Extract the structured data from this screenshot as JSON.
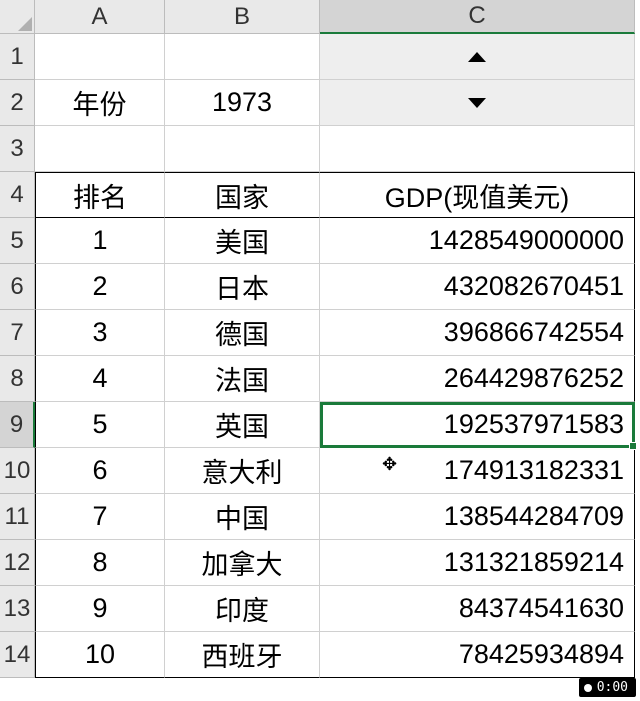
{
  "columns": [
    "A",
    "B",
    "C"
  ],
  "rows": [
    "1",
    "2",
    "3",
    "4",
    "5",
    "6",
    "7",
    "8",
    "9",
    "10",
    "11",
    "12",
    "13",
    "14"
  ],
  "cells": {
    "A2": "年份",
    "B2": "1973",
    "A4": "排名",
    "B4": "国家",
    "C4": "GDP(现值美元)"
  },
  "table": {
    "rows": [
      {
        "rank": "1",
        "country": "美国",
        "gdp": "1428549000000"
      },
      {
        "rank": "2",
        "country": "日本",
        "gdp": "432082670451"
      },
      {
        "rank": "3",
        "country": "德国",
        "gdp": "396866742554"
      },
      {
        "rank": "4",
        "country": "法国",
        "gdp": "264429876252"
      },
      {
        "rank": "5",
        "country": "英国",
        "gdp": "192537971583"
      },
      {
        "rank": "6",
        "country": "意大利",
        "gdp": "174913182331"
      },
      {
        "rank": "7",
        "country": "中国",
        "gdp": "138544284709"
      },
      {
        "rank": "8",
        "country": "加拿大",
        "gdp": "131321859214"
      },
      {
        "rank": "9",
        "country": "印度",
        "gdp": "84374541630"
      },
      {
        "rank": "10",
        "country": "西班牙",
        "gdp": "78425934894"
      }
    ]
  },
  "spinner": {
    "up": "▲",
    "down": "▼"
  },
  "active_cell": "C9",
  "timer": "0:00",
  "chart_data": {
    "type": "table",
    "title": "GDP(现值美元) 1973",
    "columns": [
      "排名",
      "国家",
      "GDP(现值美元)"
    ],
    "data": [
      [
        1,
        "美国",
        1428549000000
      ],
      [
        2,
        "日本",
        432082670451
      ],
      [
        3,
        "德国",
        396866742554
      ],
      [
        4,
        "法国",
        264429876252
      ],
      [
        5,
        "英国",
        192537971583
      ],
      [
        6,
        "意大利",
        174913182331
      ],
      [
        7,
        "中国",
        138544284709
      ],
      [
        8,
        "加拿大",
        131321859214
      ],
      [
        9,
        "印度",
        84374541630
      ],
      [
        10,
        "西班牙",
        78425934894
      ]
    ]
  }
}
